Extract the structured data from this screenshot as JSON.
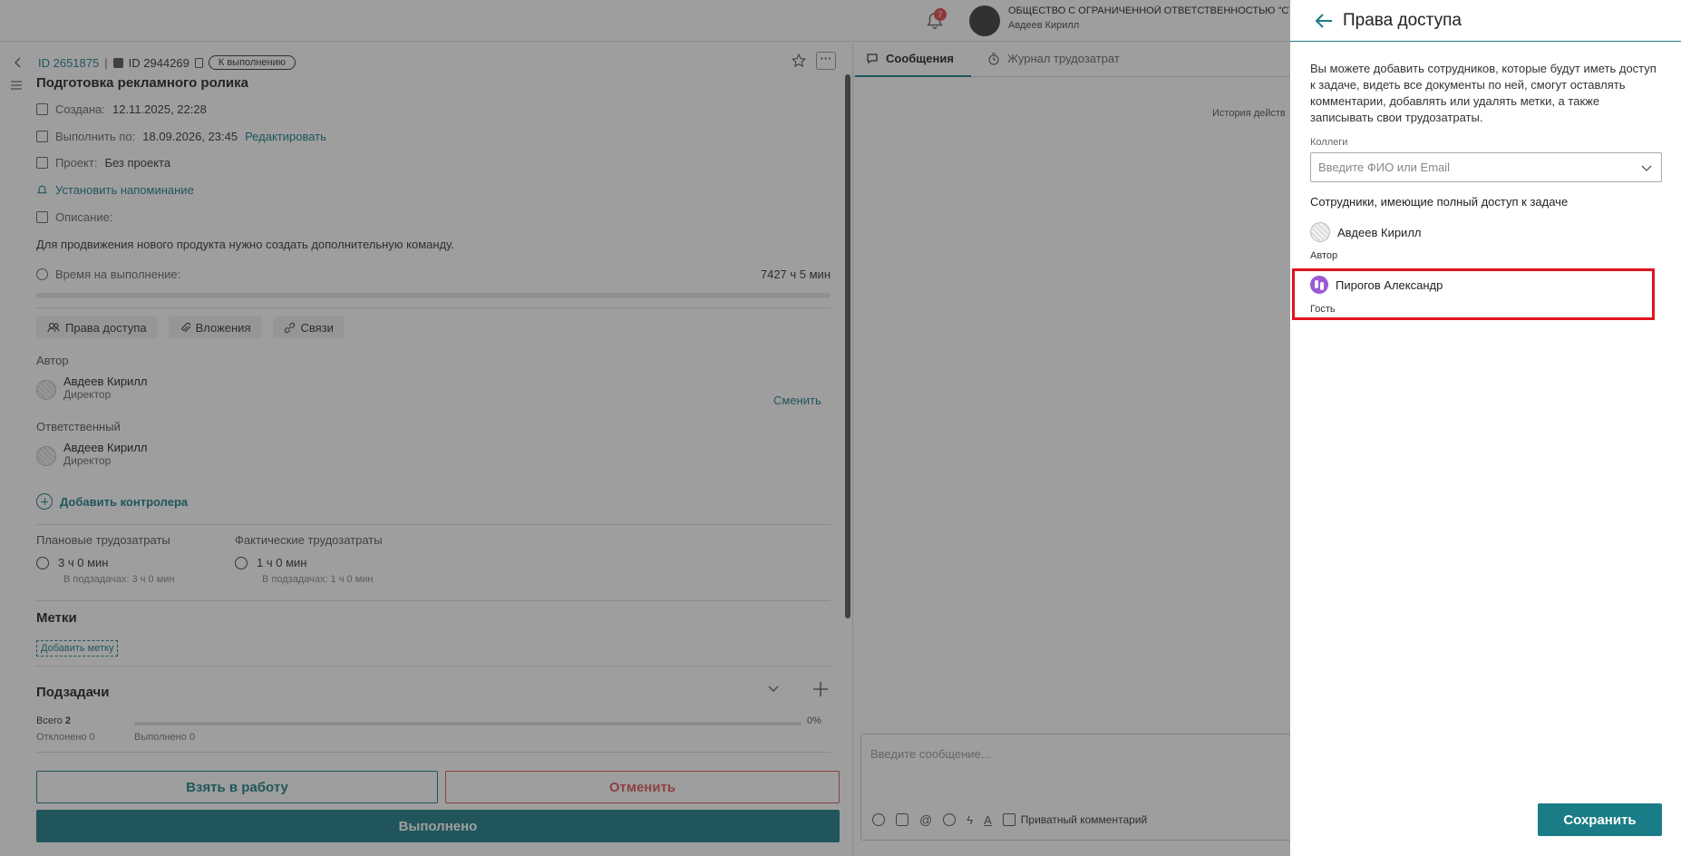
{
  "topbar": {
    "notifications_count": "7",
    "org_name": "ОБЩЕСТВО С ОГРАНИЧЕННОЙ ОТВЕТСТВЕННОСТЬЮ \"СТАР",
    "user_name": "Авдеев Кирилл"
  },
  "task": {
    "id_label": "ID 2651875",
    "id2_label": "ID 2944269",
    "status": "К выполнению",
    "title": "Подготовка рекламного ролика",
    "created_label": "Создана:",
    "created_value": "12.11.2025, 22:28",
    "due_label": "Выполнить по:",
    "due_value": "18.09.2026, 23:45",
    "edit_link": "Редактировать",
    "project_label": "Проект:",
    "project_value": "Без проекта",
    "reminder_link": "Установить напоминание",
    "description_label": "Описание:",
    "description": "Для продвижения нового продукта нужно создать дополнительную команду.",
    "time_label": "Время на выполнение:",
    "time_value": "7427 ч 5 мин",
    "tabs": [
      "Права доступа",
      "Вложения",
      "Связи"
    ],
    "author_label": "Автор",
    "author_name": "Авдеев Кирилл",
    "author_role": "Директор",
    "responsible_label": "Ответственный",
    "responsible_name": "Авдеев Кирилл",
    "responsible_role": "Директор",
    "change_link": "Сменить",
    "add_controller": "Добавить контролера",
    "planned_label": "Плановые трудозатраты",
    "planned_value": "3 ч 0 мин",
    "planned_sub": "В подзадачах: 3 ч 0 мин",
    "actual_label": "Фактические трудозатраты",
    "actual_value": "1 ч 0 мин",
    "actual_sub": "В подзадачах: 1 ч 0 мин",
    "tags_heading": "Метки",
    "add_tag": "Добавить метку",
    "subtasks_heading": "Подзадачи",
    "subtasks_total_label": "Всего",
    "subtasks_total": "2",
    "subtasks_rejected": "Отклонено 0",
    "subtasks_done": "Выполнено 0",
    "subtasks_percent": "0%",
    "take_button": "Взять в работу",
    "cancel_button": "Отменить",
    "done_button": "Выполнено"
  },
  "messages": {
    "tab_messages": "Сообщения",
    "tab_journal": "Журнал трудозатрат",
    "history": "История действ",
    "composer_placeholder": "Введите сообщение...",
    "private_comment": "Приватный комментарий"
  },
  "panel": {
    "title": "Права доступа",
    "description": "Вы можете добавить сотрудников, которые будут иметь доступ к задаче, видеть все документы по ней, смогут оставлять комментарии, добавлять или удалять метки, а также записывать свои трудозатраты.",
    "colleagues_label": "Коллеги",
    "search_placeholder": "Введите ФИО или Email",
    "full_access_label": "Сотрудники, имеющие полный доступ к задаче",
    "members": [
      {
        "name": "Авдеев Кирилл",
        "role": "Автор"
      },
      {
        "name": "Пирогов Александр",
        "role": "Гость"
      }
    ],
    "save_button": "Сохранить"
  },
  "colors": {
    "accent": "#1a7c86",
    "danger": "#e05656",
    "highlight": "#e0141e",
    "guest_avatar": "#9b59d6"
  }
}
